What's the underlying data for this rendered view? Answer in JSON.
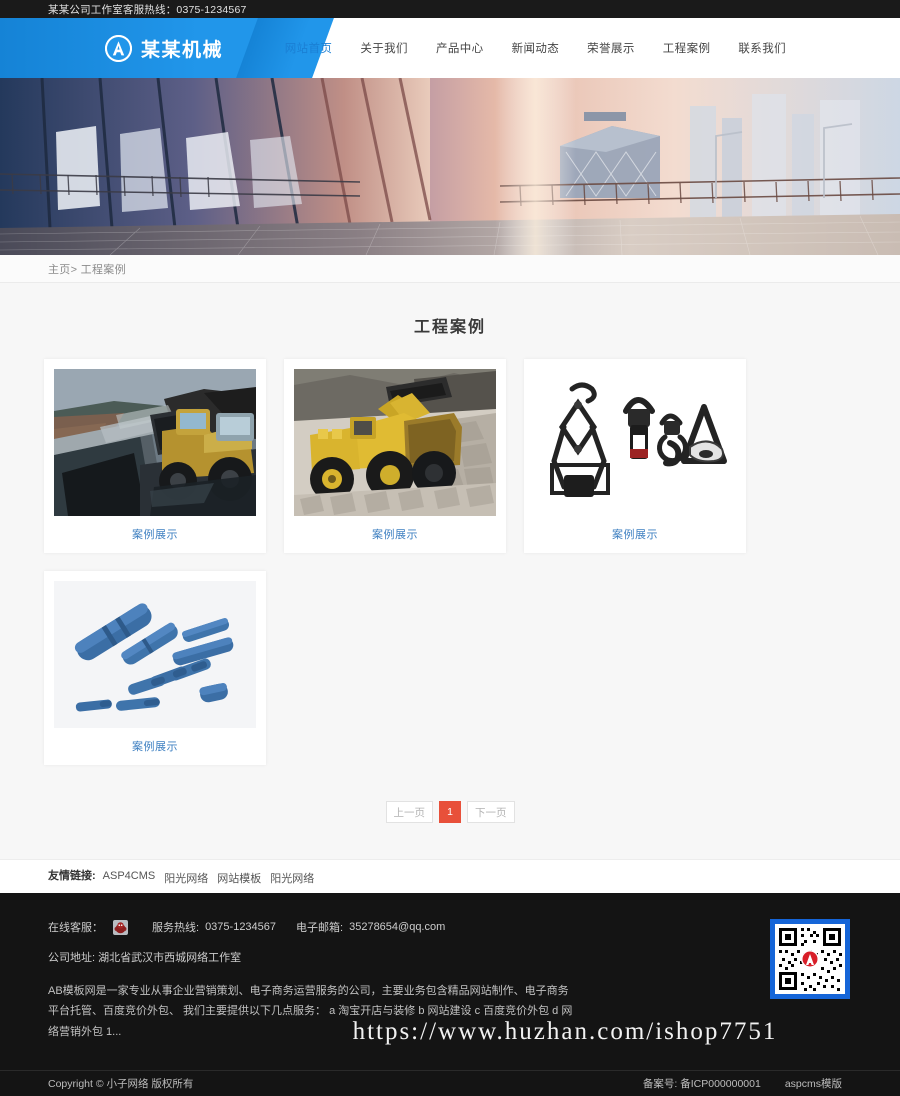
{
  "topbar": {
    "hotline_text": "某某公司工作室客服热线：0375-1234567"
  },
  "header": {
    "logo_text": "某某机械",
    "logo_icon": "circle-a-logo-icon",
    "nav": [
      {
        "label": "网站首页",
        "active": true
      },
      {
        "label": "关于我们",
        "active": false
      },
      {
        "label": "产品中心",
        "active": false
      },
      {
        "label": "新闻动态",
        "active": false
      },
      {
        "label": "荣誉展示",
        "active": false
      },
      {
        "label": "工程案例",
        "active": false
      },
      {
        "label": "联系我们",
        "active": false
      }
    ]
  },
  "banner": {
    "alt": "城市天台玻璃幕墙全景横幅"
  },
  "breadcrumb": {
    "text": "主页> 工程案例"
  },
  "main": {
    "page_title": "工程案例",
    "cards": [
      {
        "caption": "案例展示",
        "image": "coal-loader-mine-photo"
      },
      {
        "caption": "案例展示",
        "image": "yellow-wheel-loader-quarry-photo"
      },
      {
        "caption": "案例展示",
        "image": "black-lifting-clamps-photo"
      },
      {
        "caption": "案例展示",
        "image": "blue-drill-rod-couplings-photo"
      }
    ],
    "pagination": {
      "prev_label": "上一页",
      "next_label": "下一页",
      "pages": [
        "1"
      ],
      "current": "1",
      "active_color": "#e8503a"
    }
  },
  "friend_links": {
    "label": "友情链接:",
    "items": [
      "ASP4CMS",
      "阳光网络",
      "网站模板",
      "阳光网络"
    ]
  },
  "footer": {
    "online_service_label": "在线客服：",
    "service_icon": "qq-customer-service-icon",
    "hotline_label": "服务热线:",
    "hotline_value": "0375-1234567",
    "email_label": "电子邮箱:",
    "email_value": "35278654@qq.com",
    "address_label": "公司地址:",
    "address_value": "湖北省武汉市西城网络工作室",
    "description": "AB模板网是一家专业从事企业营销策划、电子商务运营服务的公司，主要业务包含精品网站制作、电子商务平台托管、百度竞价外包、 我们主要提供以下几点服务： a 淘宝开店与装修 b 网站建设 c 百度竞价外包 d 网络营销外包 1...",
    "qr_code": {
      "icon": "qr-code-image",
      "border_color": "#1565d8"
    },
    "watermark": "https://www.huzhan.com/ishop7751",
    "copyright": "Copyright © 小子网络 版权所有",
    "record_label": "备案号:",
    "record_value": "备ICP000000001",
    "cms_label": "aspcms模版"
  }
}
